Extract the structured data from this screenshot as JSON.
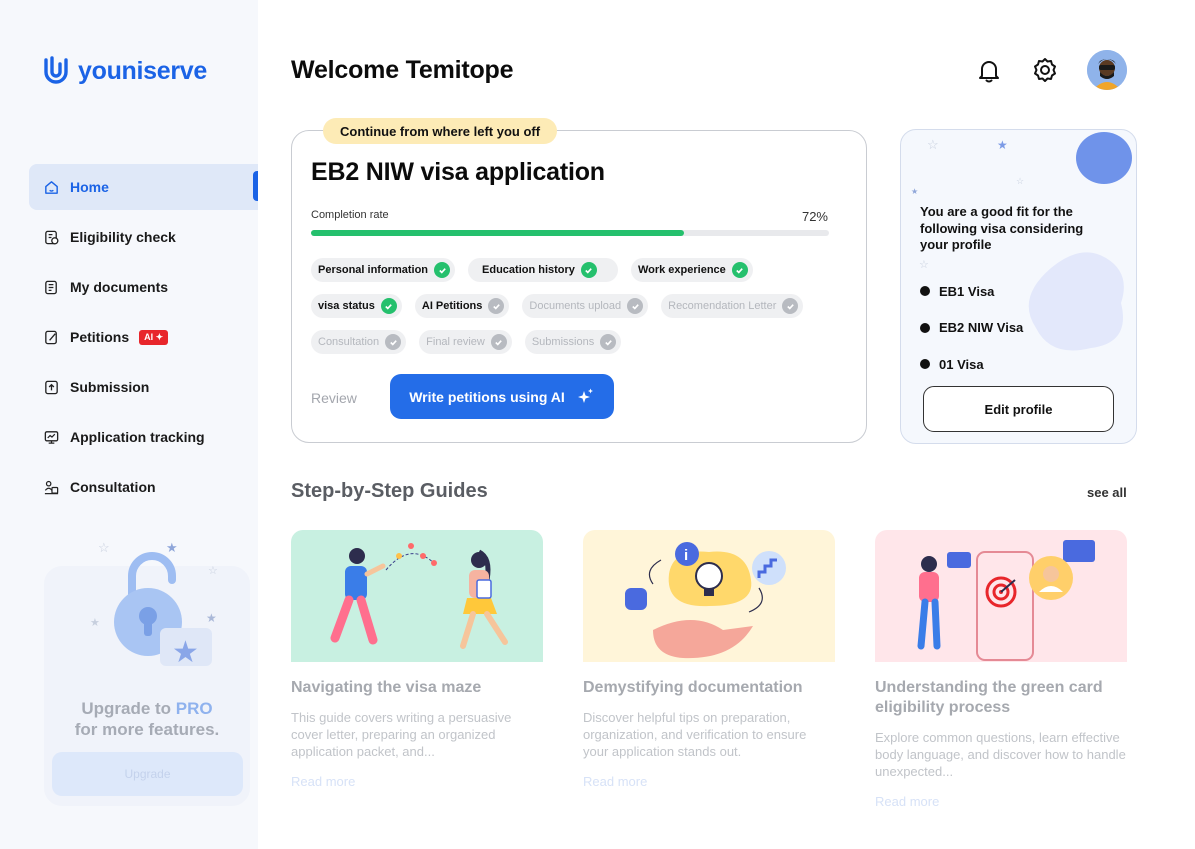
{
  "brand": {
    "name": "youniserve",
    "color": "#1b63e6"
  },
  "sidebar": {
    "items": [
      {
        "label": "Home",
        "icon": "home-icon",
        "active": true
      },
      {
        "label": "Eligibility check",
        "icon": "eligibility-icon"
      },
      {
        "label": "My documents",
        "icon": "documents-icon"
      },
      {
        "label": "Petitions",
        "icon": "petitions-icon",
        "badge": "AI ✦"
      },
      {
        "label": "Submission",
        "icon": "upload-icon"
      },
      {
        "label": "Application tracking",
        "icon": "tracking-icon"
      },
      {
        "label": "Consultation",
        "icon": "consultation-icon"
      }
    ],
    "upgrade": {
      "line1_a": "Upgrade to ",
      "line1_b": "PRO",
      "line2": "for more features.",
      "button": "Upgrade"
    }
  },
  "header": {
    "welcome": "Welcome Temitope",
    "icons": [
      "bell-icon",
      "gear-icon",
      "avatar"
    ]
  },
  "application": {
    "continue_label": "Continue from where left you off",
    "title": "EB2 NIW visa application",
    "completion_label": "Completion rate",
    "completion_text": "72%",
    "completion": 0.72,
    "steps_rows": [
      [
        {
          "label": "Personal information",
          "done": true
        },
        {
          "label": "Education history",
          "done": true
        },
        {
          "label": "Work experience",
          "done": true
        }
      ],
      [
        {
          "label": "visa status",
          "done": true
        },
        {
          "label": "AI Petitions",
          "done": false,
          "bold": true
        },
        {
          "label": "Documents upload",
          "done": false
        },
        {
          "label": "Recomendation Letter",
          "done": false
        }
      ],
      [
        {
          "label": "Consultation",
          "done": false
        },
        {
          "label": "Final review",
          "done": false
        },
        {
          "label": "Submissions",
          "done": false
        }
      ]
    ],
    "review_label": "Review",
    "ai_button": "Write petitions using AI"
  },
  "fit": {
    "title": "You are a good fit for the following visa considering your profile",
    "visas": [
      "EB1 Visa",
      "EB2 NIW Visa",
      "01 Visa"
    ],
    "edit_button": "Edit profile"
  },
  "guides": {
    "title": "Step-by-Step Guides",
    "see_all": "see all",
    "cards": [
      {
        "title": "Navigating the visa maze",
        "desc": "This guide covers writing a persuasive cover letter, preparing an organized application packet, and...",
        "link": "Read more",
        "bg": "#c8f0e1"
      },
      {
        "title": "Demystifying documentation",
        "desc": "Discover helpful tips on preparation, organization, and verification to ensure your application stands out.",
        "link": "Read more",
        "bg": "#fff5d9"
      },
      {
        "title": "Understanding the green card eligibility process",
        "desc": "Explore common questions, learn effective body language, and discover how to handle unexpected...",
        "link": "Read more",
        "bg": "#ffe6ea"
      }
    ]
  }
}
